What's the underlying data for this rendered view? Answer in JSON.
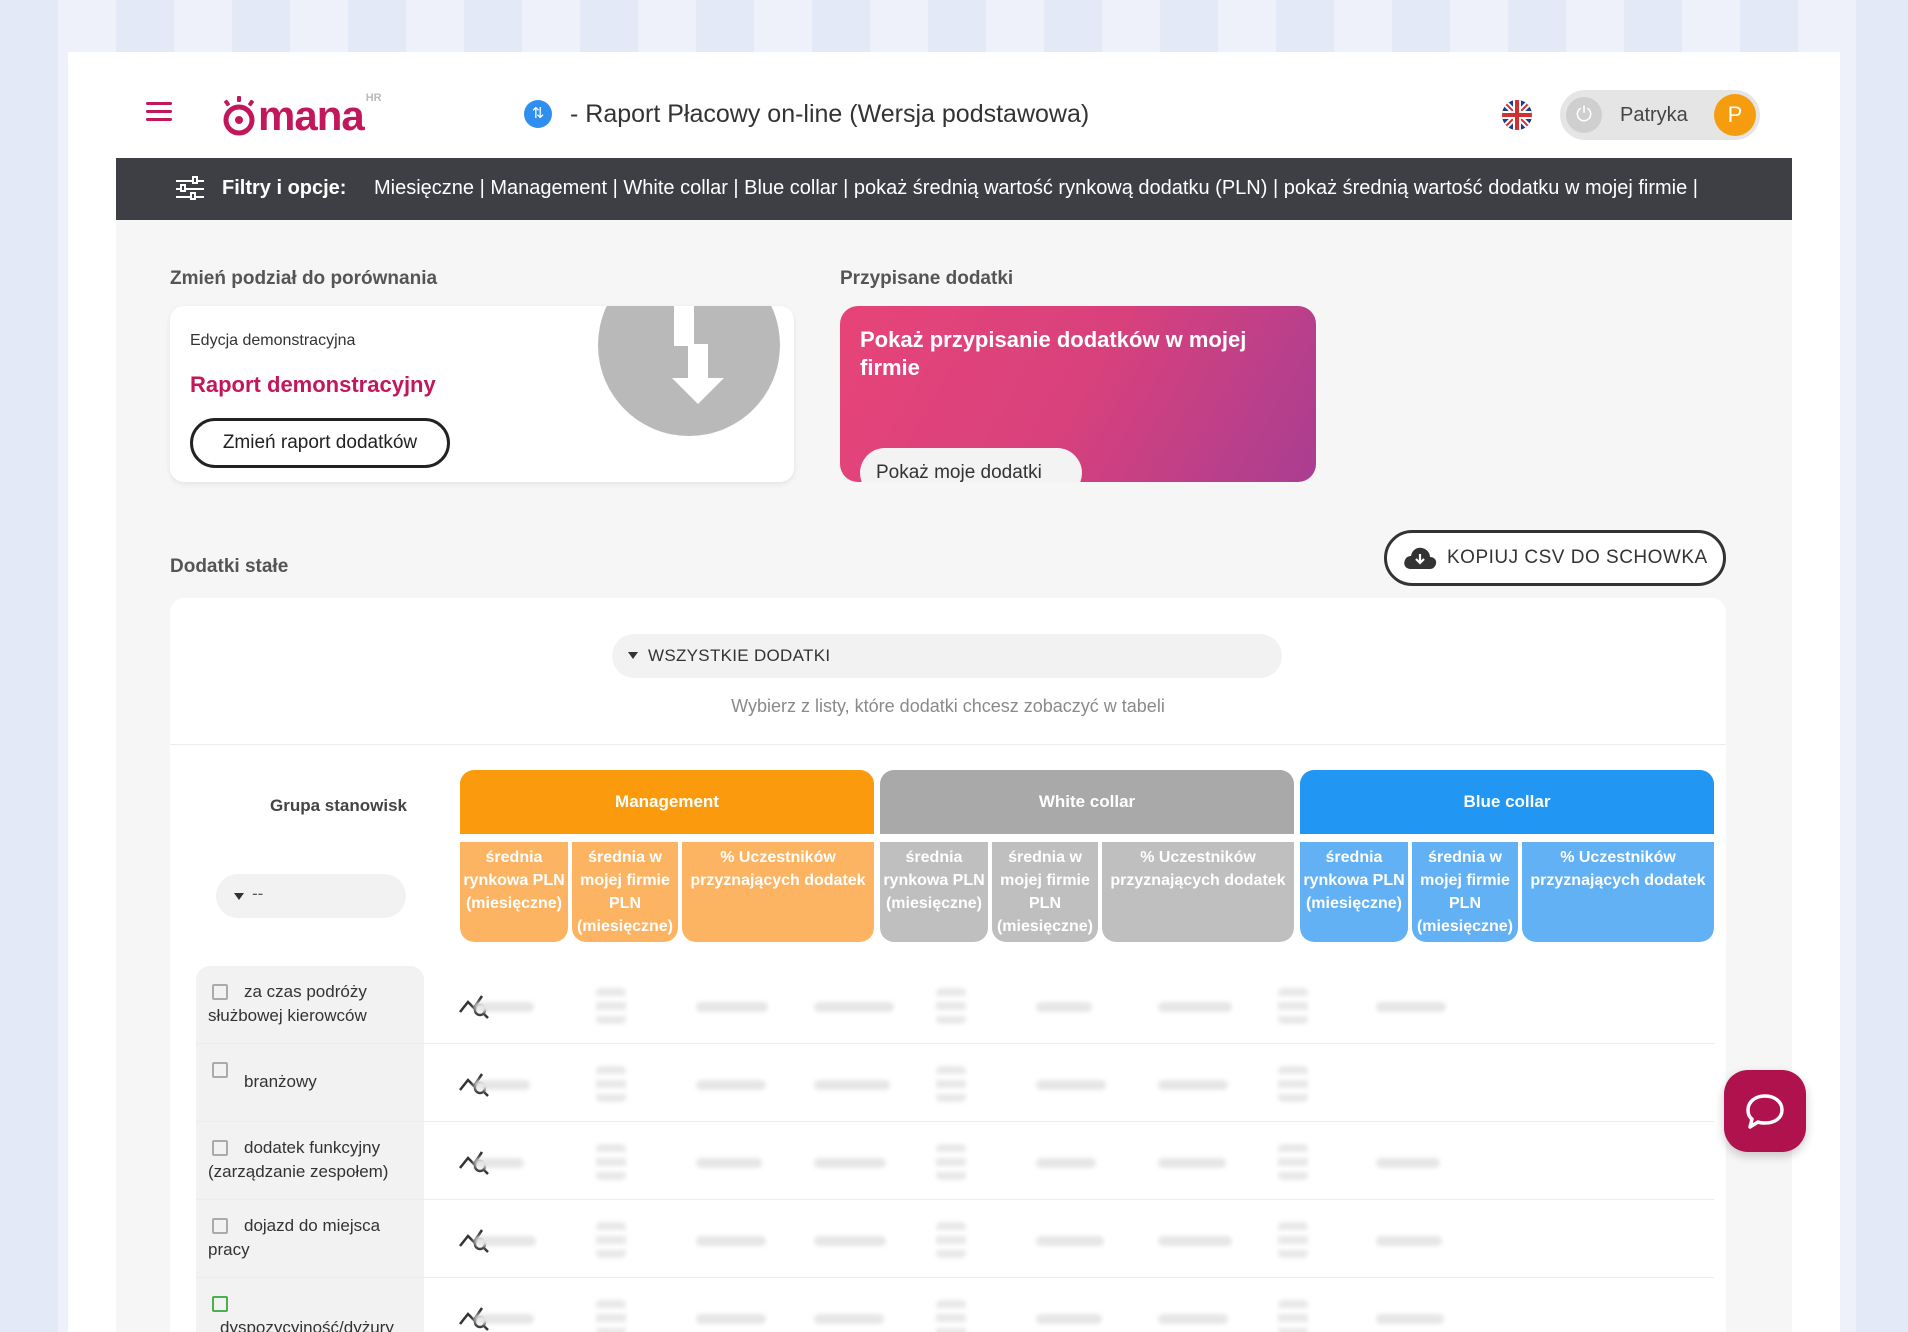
{
  "header": {
    "logo_text": "mana",
    "logo_sup": "HR",
    "app_title": "- Raport Płacowy on-line (Wersja podstawowa)",
    "user_name": "Patryka",
    "user_initial": "P"
  },
  "filters": {
    "label": "Filtry i opcje:",
    "values": "Miesięczne | Management | White collar | Blue collar | pokaż średnią wartość rynkową dodatku (PLN) | pokaż średnią wartość dodatku w mojej firmie |"
  },
  "compare": {
    "section_label": "Zmień podział do porównania",
    "edition": "Edycja demonstracyjna",
    "report_name": "Raport demonstracyjny",
    "change_button": "Zmień raport dodatków"
  },
  "assigned": {
    "section_label": "Przypisane dodatki",
    "title": "Pokaż przypisanie dodatków w mojej firmie",
    "button": "Pokaż moje dodatki"
  },
  "fixed": {
    "section_label": "Dodatki stałe",
    "csv_button": "KOPIUJ CSV DO SCHOWKA",
    "all_dropdown": "WSZYSTKIE DODATKI",
    "hint": "Wybierz z listy, które dodatki chcesz zobaczyć w tabeli",
    "group_label": "Grupa stanowisk",
    "group_value": "--"
  },
  "table": {
    "groups": [
      {
        "name": "Management",
        "color": "#fb9a0d",
        "sub_color": "#fdb462"
      },
      {
        "name": "White collar",
        "color": "#a9a9a9",
        "sub_color": "#bfbfbf"
      },
      {
        "name": "Blue collar",
        "color": "#2196f3",
        "sub_color": "#63b1f5"
      }
    ],
    "sub_headers": [
      "średnia rynkowa PLN (miesięczne)",
      "średnia w mojej firmie PLN (miesięczne)",
      "% Uczestników przyznających dodatek"
    ],
    "rows": [
      {
        "name": "za czas podróży służbowej kierowców",
        "checked": false
      },
      {
        "name": "branżowy",
        "checked": false
      },
      {
        "name": "dodatek funkcyjny (zarządzanie zespołem)",
        "checked": false
      },
      {
        "name": "dojazd do miejsca pracy",
        "checked": false
      },
      {
        "name": "dyspozycyjność/dyżury",
        "checked": true
      }
    ]
  },
  "icons": {
    "menu": "hamburger-icon",
    "app": "arrows-icon",
    "language": "uk-flag-icon",
    "power": "power-icon",
    "filters": "sliders-icon",
    "csv": "cloud-download-icon",
    "trend": "trend-search-icon",
    "chat": "chat-icon"
  }
}
